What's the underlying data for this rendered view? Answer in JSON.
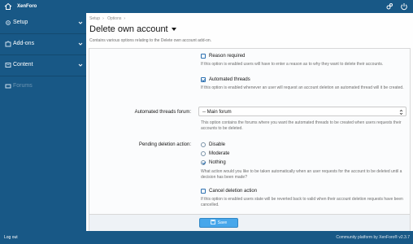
{
  "topbar": {
    "brand": "XenForo"
  },
  "sidebar": {
    "items": [
      {
        "label": "Setup",
        "icon": "gear-icon"
      },
      {
        "label": "Add-ons",
        "icon": "puzzle-icon"
      },
      {
        "label": "Content",
        "icon": "content-icon"
      },
      {
        "label": "Forums",
        "icon": "forums-icon"
      }
    ]
  },
  "bottombar": {
    "logout": "Log out",
    "credit": "Community platform by XenForo® v2.3.7"
  },
  "breadcrumbs": [
    "Setup",
    "Options"
  ],
  "page": {
    "title": "Delete own account",
    "description": "Contains various options relating to the Delete own account add-on."
  },
  "options": {
    "reason_required": {
      "label": "Reason required",
      "checked": false,
      "hint": "If this option is enabled users will have to enter a reason as to why they want to delete their accounts."
    },
    "automated_threads": {
      "label": "Automated threads",
      "checked": true,
      "hint": "If this option is enabled whenever an user will request an account deletion an automated thread will it be created."
    },
    "threads_forum": {
      "label": "Automated threads forum:",
      "value": "-- Main forum",
      "hint": "This option contains the forums where you want the automated threads to be created when users requests their accounts to be deleted."
    },
    "pending_action": {
      "label": "Pending deletion action:",
      "choices": [
        "Disable",
        "Moderate",
        "Nothing"
      ],
      "selected": "Nothing",
      "hint": "What action would you like to be taken automatically when an user requests for the account to be deleted until a decision has been made?"
    },
    "cancel_deletion": {
      "label": "Cancel deletion action",
      "checked": false,
      "hint": "If this option is enabled users state will be reverted back to valid when their account deletion requests have been cancelled."
    }
  },
  "actions": {
    "save": "Save"
  },
  "colors": {
    "header": "#185886",
    "accent": "#47a7eb",
    "link": "#2a6fb0"
  }
}
